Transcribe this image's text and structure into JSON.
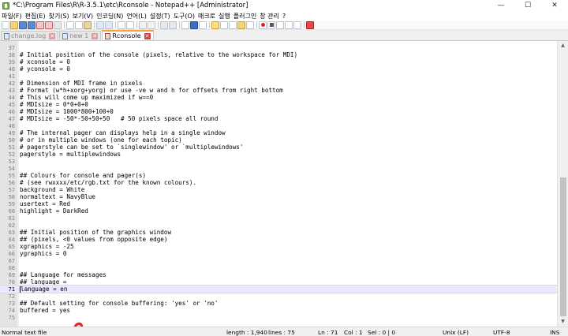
{
  "window": {
    "title": "*C:\\Program Files\\R\\R-3.5.1\\etc\\Rconsole - Notepad++ [Administrator]",
    "controls": {
      "minimize": "—",
      "maximize": "☐",
      "close": "✕"
    }
  },
  "menu": [
    "파일(F)",
    "편집(E)",
    "찾기(S)",
    "보기(V)",
    "인코딩(N)",
    "언어(L)",
    "설정(T)",
    "도구(O)",
    "매크로",
    "실행",
    "플러그인",
    "창 관리",
    "?"
  ],
  "tabs": [
    {
      "label": "change.log",
      "active": false,
      "icon": "file-icon"
    },
    {
      "label": "new 1",
      "active": false,
      "icon": "file-icon"
    },
    {
      "label": "Rconsole",
      "active": true,
      "icon": "modified-file-icon"
    }
  ],
  "editor": {
    "lines": [
      {
        "n": "37",
        "text": ""
      },
      {
        "n": "38",
        "text": "# Initial position of the console (pixels, relative to the workspace for MDI)"
      },
      {
        "n": "39",
        "text": "# xconsole = 0"
      },
      {
        "n": "40",
        "text": "# yconsole = 0"
      },
      {
        "n": "41",
        "text": ""
      },
      {
        "n": "42",
        "text": "# Dimension of MDI frame in pixels"
      },
      {
        "n": "43",
        "text": "# Format (w*h+xorg+yorg) or use -ve w and h for offsets from right bottom"
      },
      {
        "n": "44",
        "text": "# This will come up maximized if w==0"
      },
      {
        "n": "45",
        "text": "# MDIsize = 0*0+0+0"
      },
      {
        "n": "46",
        "text": "# MDIsize = 1000*800+100+0"
      },
      {
        "n": "47",
        "text": "# MDIsize = -50*-50+50+50   # 50 pixels space all round"
      },
      {
        "n": "48",
        "text": ""
      },
      {
        "n": "49",
        "text": "# The internal pager can displays help in a single window"
      },
      {
        "n": "50",
        "text": "# or in multiple windows (one for each topic)"
      },
      {
        "n": "51",
        "text": "# pagerstyle can be set to `singlewindow' or `multiplewindows'"
      },
      {
        "n": "52",
        "text": "pagerstyle = multiplewindows"
      },
      {
        "n": "53",
        "text": ""
      },
      {
        "n": "54",
        "text": ""
      },
      {
        "n": "55",
        "text": "## Colours for console and pager(s)"
      },
      {
        "n": "56",
        "text": "# (see rwxxxx/etc/rgb.txt for the known colours)."
      },
      {
        "n": "57",
        "text": "background = White"
      },
      {
        "n": "58",
        "text": "normaltext = NavyBlue"
      },
      {
        "n": "59",
        "text": "usertext = Red"
      },
      {
        "n": "60",
        "text": "highlight = DarkRed"
      },
      {
        "n": "61",
        "text": ""
      },
      {
        "n": "62",
        "text": ""
      },
      {
        "n": "63",
        "text": "## Initial position of the graphics window"
      },
      {
        "n": "64",
        "text": "## (pixels, <0 values from opposite edge)"
      },
      {
        "n": "65",
        "text": "xgraphics = -25"
      },
      {
        "n": "66",
        "text": "ygraphics = 0"
      },
      {
        "n": "67",
        "text": ""
      },
      {
        "n": "68",
        "text": ""
      },
      {
        "n": "69",
        "text": "## Language for messages"
      },
      {
        "n": "70",
        "text": "## language = "
      },
      {
        "n": "71",
        "text": "language = en",
        "current": true
      },
      {
        "n": "72",
        "text": ""
      },
      {
        "n": "73",
        "text": "## Default setting for console buffering: 'yes' or 'no'"
      },
      {
        "n": "74",
        "text": "buffered = yes"
      },
      {
        "n": "75",
        "text": ""
      }
    ],
    "annotation_color": "#e8211a"
  },
  "status": {
    "file_type": "Normal text file",
    "length": "length : 1,940",
    "lines": "lines : 75",
    "ln": "Ln : 71",
    "col": "Col : 1",
    "sel": "Sel : 0 | 0",
    "eol": "Unix (LF)",
    "encoding": "UTF-8",
    "mode": "INS"
  }
}
